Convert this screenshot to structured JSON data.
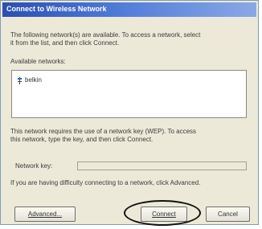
{
  "window": {
    "title": "Connect to Wireless Network"
  },
  "instructions": {
    "line1": "The following network(s) are available. To access a network, select",
    "line2": "it from the list, and then click Connect."
  },
  "networks": {
    "label": "Available networks:",
    "items": [
      {
        "name": "belkin"
      }
    ]
  },
  "key_notice": {
    "line1": "This network requires the use of a network key (WEP). To access",
    "line2": "this network, type the key, and then click Connect."
  },
  "network_key": {
    "label": "Network key:",
    "value": ""
  },
  "advanced_hint": "If you are having difficulty connecting to a network, click Advanced.",
  "buttons": {
    "advanced": "Advanced...",
    "connect": "Connect",
    "cancel": "Cancel"
  }
}
